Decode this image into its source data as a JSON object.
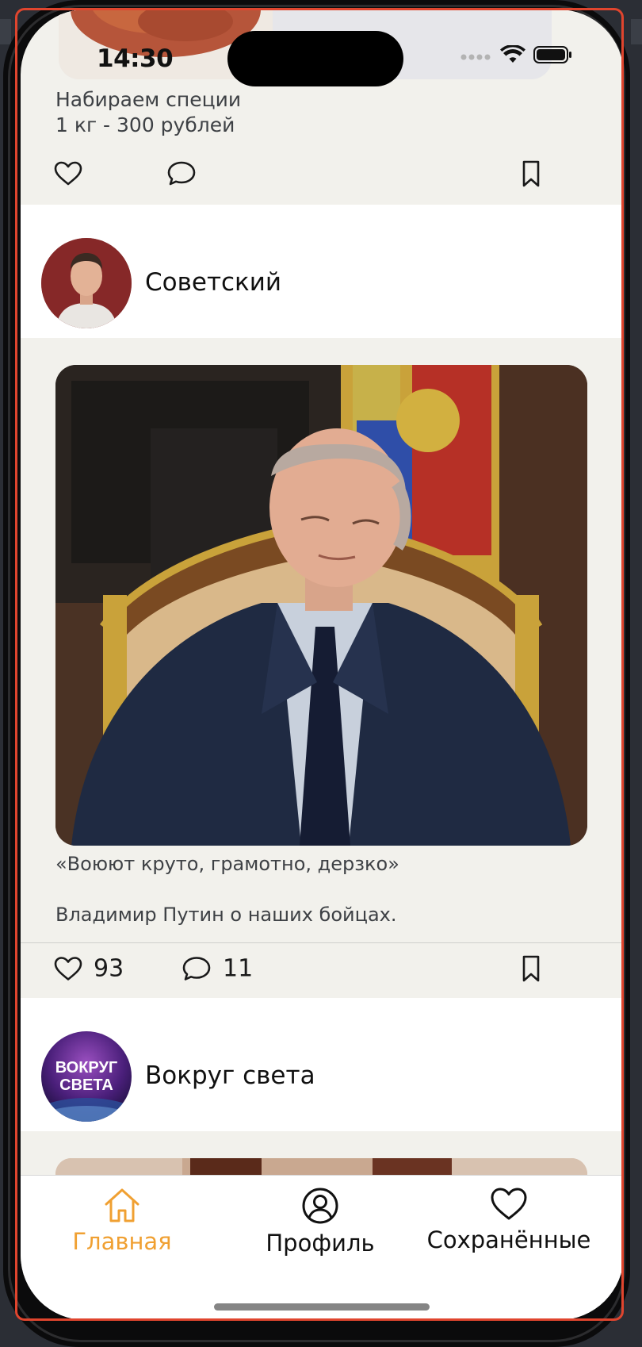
{
  "status_bar": {
    "time": "14:30"
  },
  "prev_post": {
    "caption_line1": "Набираем специи",
    "caption_line2": "1 кг - 300 рублей"
  },
  "post": {
    "author": "Советский",
    "text_line1": "«Воюют круто, грамотно, дерзко»",
    "text_line2": "Владимир Путин о наших бойцах.",
    "likes": "93",
    "comments": "11"
  },
  "next_post": {
    "author": "Вокруг света",
    "avatar_line1": "ВОКРУГ",
    "avatar_line2": "СВЕТА"
  },
  "tabbar": {
    "tabs": [
      {
        "label": "Главная",
        "icon": "home-icon",
        "active": true
      },
      {
        "label": "Профиль",
        "icon": "profile-icon",
        "active": false
      },
      {
        "label": "Сохранённые",
        "icon": "heart-icon",
        "active": false
      }
    ],
    "active_color": "#f0a032",
    "inactive_color": "#111111"
  }
}
